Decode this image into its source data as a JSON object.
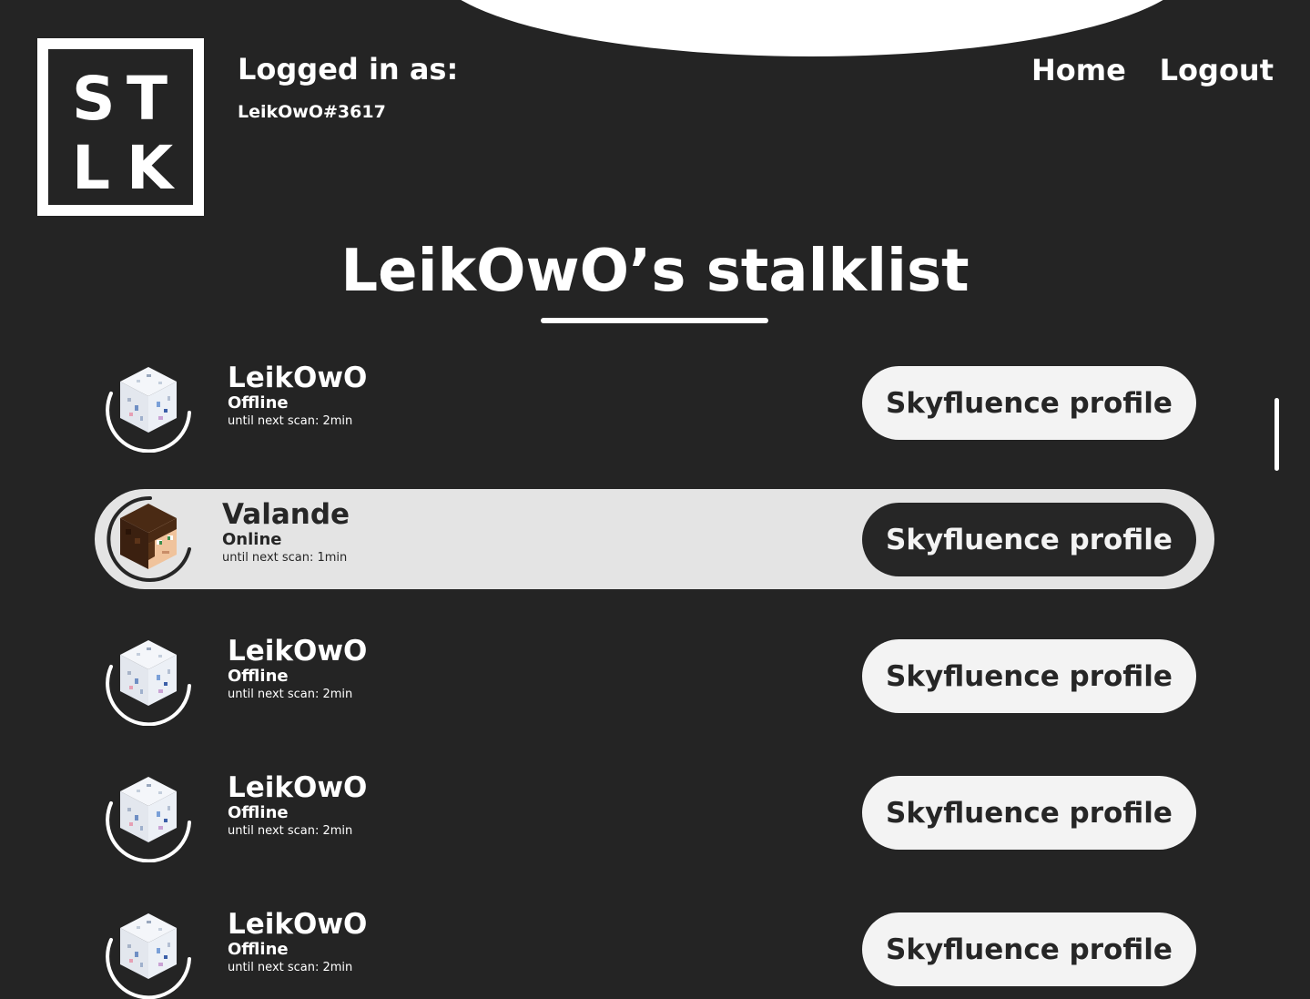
{
  "header": {
    "logo_letters": {
      "s": "S",
      "t": "T",
      "l": "L",
      "k": "K"
    },
    "login_label": "Logged in as:",
    "login_user": "LeikOwO#3617",
    "nav": {
      "home": "Home",
      "logout": "Logout"
    }
  },
  "page": {
    "title": "LeikOwO’s stalklist"
  },
  "players": [
    {
      "name": "LeikOwO",
      "status": "Offline",
      "scan": "until next scan: 2min",
      "button": "Skyfluence profile",
      "avatar": "white-block-head-icon"
    },
    {
      "name": "Valande",
      "status": "Online",
      "scan": "until next scan: 1min",
      "button": "Skyfluence profile",
      "avatar": "brown-hair-head-icon"
    },
    {
      "name": "LeikOwO",
      "status": "Offline",
      "scan": "until next scan: 2min",
      "button": "Skyfluence profile",
      "avatar": "white-block-head-icon"
    },
    {
      "name": "LeikOwO",
      "status": "Offline",
      "scan": "until next scan: 2min",
      "button": "Skyfluence profile",
      "avatar": "white-block-head-icon"
    },
    {
      "name": "LeikOwO",
      "status": "Offline",
      "scan": "until next scan: 2min",
      "button": "Skyfluence profile",
      "avatar": "white-block-head-icon"
    }
  ],
  "colors": {
    "background": "#242424",
    "foreground": "#ffffff",
    "highlight_row": "#e4e4e4",
    "button_light": "#f3f3f3",
    "button_dark": "#262626"
  }
}
